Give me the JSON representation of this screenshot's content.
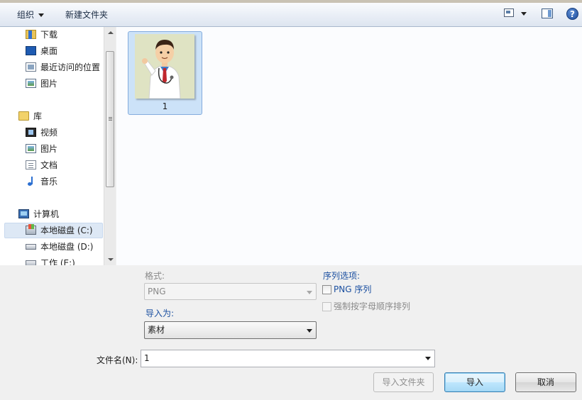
{
  "toolbar": {
    "organize_label": "组织",
    "new_folder_label": "新建文件夹",
    "help_glyph": "?"
  },
  "nav": {
    "favorites": [
      {
        "label": "下载",
        "icon": "download-folder-icon"
      },
      {
        "label": "桌面",
        "icon": "desktop-icon"
      },
      {
        "label": "最近访问的位置",
        "icon": "recent-places-icon"
      },
      {
        "label": "图片",
        "icon": "pictures-icon"
      }
    ],
    "library": {
      "label": "库",
      "items": [
        {
          "label": "视频",
          "icon": "video-icon"
        },
        {
          "label": "图片",
          "icon": "pictures-icon"
        },
        {
          "label": "文档",
          "icon": "documents-icon"
        },
        {
          "label": "音乐",
          "icon": "music-icon"
        }
      ]
    },
    "computer": {
      "label": "计算机",
      "items": [
        {
          "label": "本地磁盘 (C:)",
          "icon": "system-drive-icon",
          "selected": true
        },
        {
          "label": "本地磁盘 (D:)",
          "icon": "drive-icon"
        },
        {
          "label": "工作 (E:)",
          "icon": "drive-icon"
        }
      ]
    }
  },
  "files": [
    {
      "name": "1",
      "type": "image-thumbnail",
      "selected": true
    }
  ],
  "options": {
    "format_label": "格式:",
    "format_value": "PNG",
    "import_as_label": "导入为:",
    "import_as_value": "素材",
    "sequence_title": "序列选项:",
    "png_sequence_label": "PNG 序列",
    "png_sequence_checked": false,
    "alpha_order_label": "强制按字母顺序排列",
    "alpha_order_checked": false
  },
  "filename": {
    "label": "文件名(N):",
    "value": "1"
  },
  "buttons": {
    "import_folder": "导入文件夹",
    "import": "导入",
    "cancel": "取消"
  },
  "colors": {
    "accent_blue": "#1a4fa0",
    "selection_bg": "#cce2f8",
    "default_button": "#bee6fd"
  }
}
